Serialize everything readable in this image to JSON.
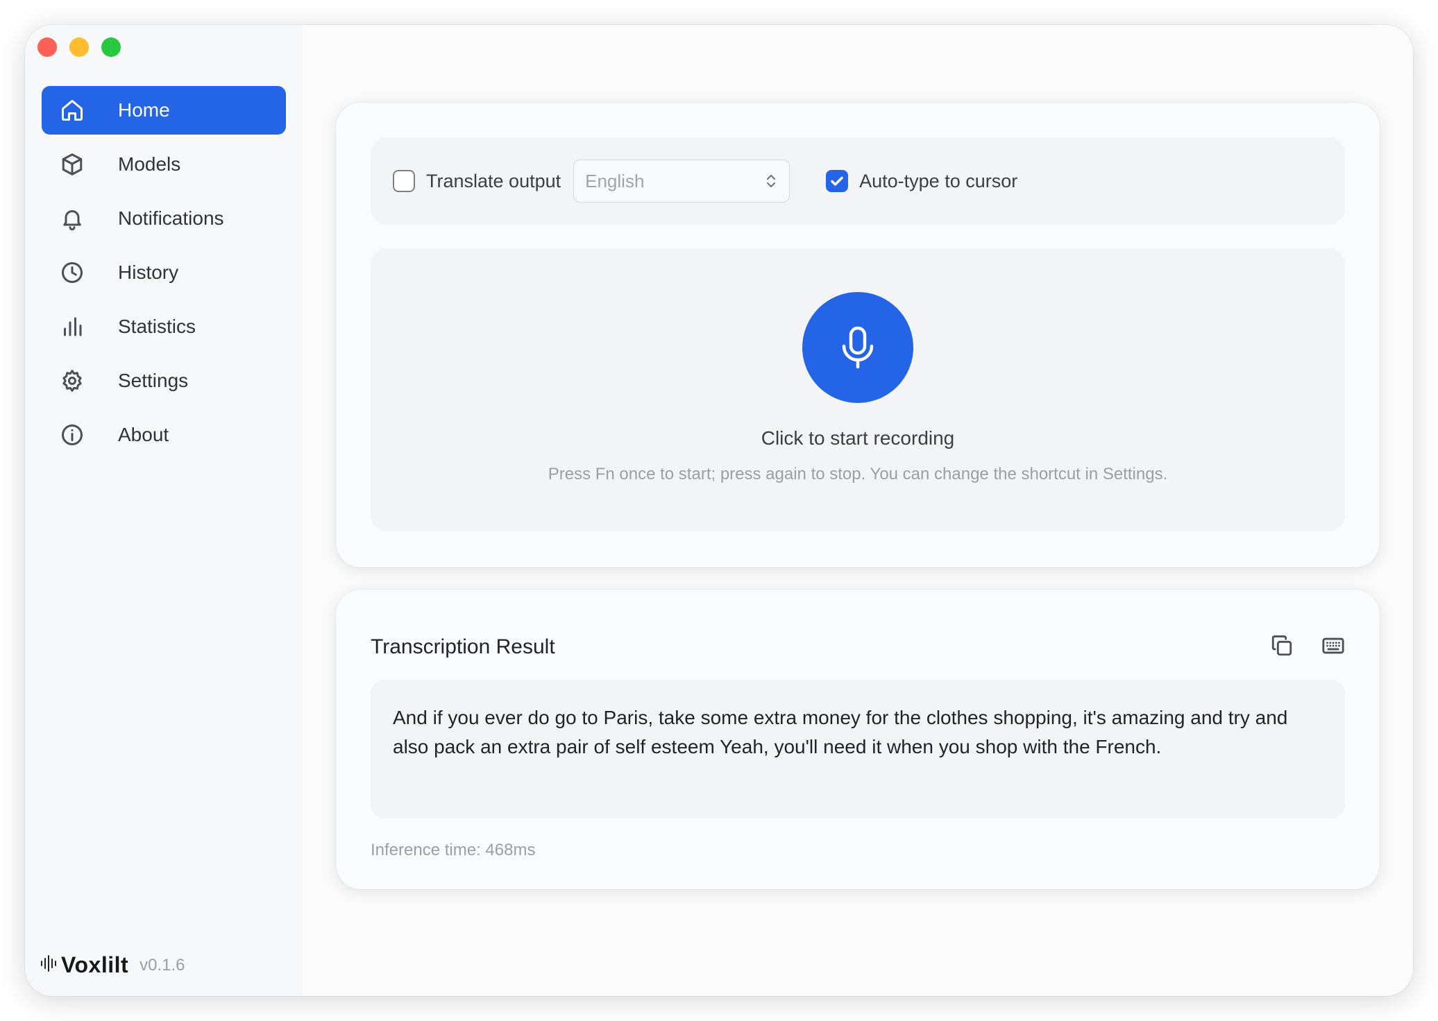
{
  "sidebar": {
    "items": [
      {
        "label": "Home",
        "icon": "home-icon",
        "active": true
      },
      {
        "label": "Models",
        "icon": "cube-icon"
      },
      {
        "label": "Notifications",
        "icon": "bell-icon"
      },
      {
        "label": "History",
        "icon": "clock-icon"
      },
      {
        "label": "Statistics",
        "icon": "bar-chart-icon"
      },
      {
        "label": "Settings",
        "icon": "gear-icon"
      },
      {
        "label": "About",
        "icon": "info-icon"
      }
    ],
    "brand": {
      "name": "Voxlilt",
      "version": "v0.1.6",
      "icon": "waveform-icon"
    }
  },
  "options": {
    "translate_label": "Translate output",
    "translate_checked": false,
    "language_value": "English",
    "autotype_label": "Auto-type to cursor",
    "autotype_checked": true
  },
  "recorder": {
    "title": "Click to start recording",
    "hint": "Press Fn once to start; press again to stop. You can change the shortcut in Settings."
  },
  "result": {
    "title": "Transcription Result",
    "text": "And if you ever do go to Paris, take some extra money for the clothes shopping, it's amazing and try and also pack an extra pair of self esteem Yeah, you'll need it when you shop with the French.",
    "inference": "Inference time: 468ms"
  },
  "colors": {
    "accent": "#2465e8",
    "traffic_red": "#fe5f57",
    "traffic_yellow": "#febc2e",
    "traffic_green": "#28c840"
  }
}
